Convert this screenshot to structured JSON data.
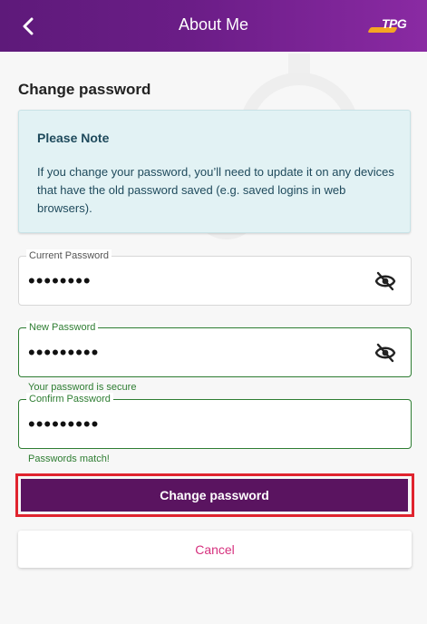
{
  "header": {
    "title": "About Me",
    "logo_text": "TPG"
  },
  "section_title": "Change password",
  "note": {
    "title": "Please Note",
    "text": "If you change your password, you’ll need to update it on any devices that have the old password saved (e.g. saved logins in web browsers)."
  },
  "fields": {
    "current": {
      "label": "Current Password",
      "value": "••••••••"
    },
    "new": {
      "label": "New Password",
      "value": "•••••••••",
      "helper": "Your password is secure"
    },
    "confirm": {
      "label": "Confirm Password",
      "value": "•••••••••",
      "helper": "Passwords match!"
    }
  },
  "buttons": {
    "primary": "Change password",
    "secondary": "Cancel"
  },
  "colors": {
    "header_gradient_start": "#5e1a7a",
    "header_gradient_end": "#8a2aa3",
    "primary_button": "#5a1460",
    "valid_green": "#2e7d32",
    "cancel_pink": "#d6317e",
    "highlight_outline": "#e0242e"
  },
  "icons": {
    "back": "chevron-left-icon",
    "visibility_current": "eye-off-icon",
    "visibility_new": "eye-off-icon"
  }
}
